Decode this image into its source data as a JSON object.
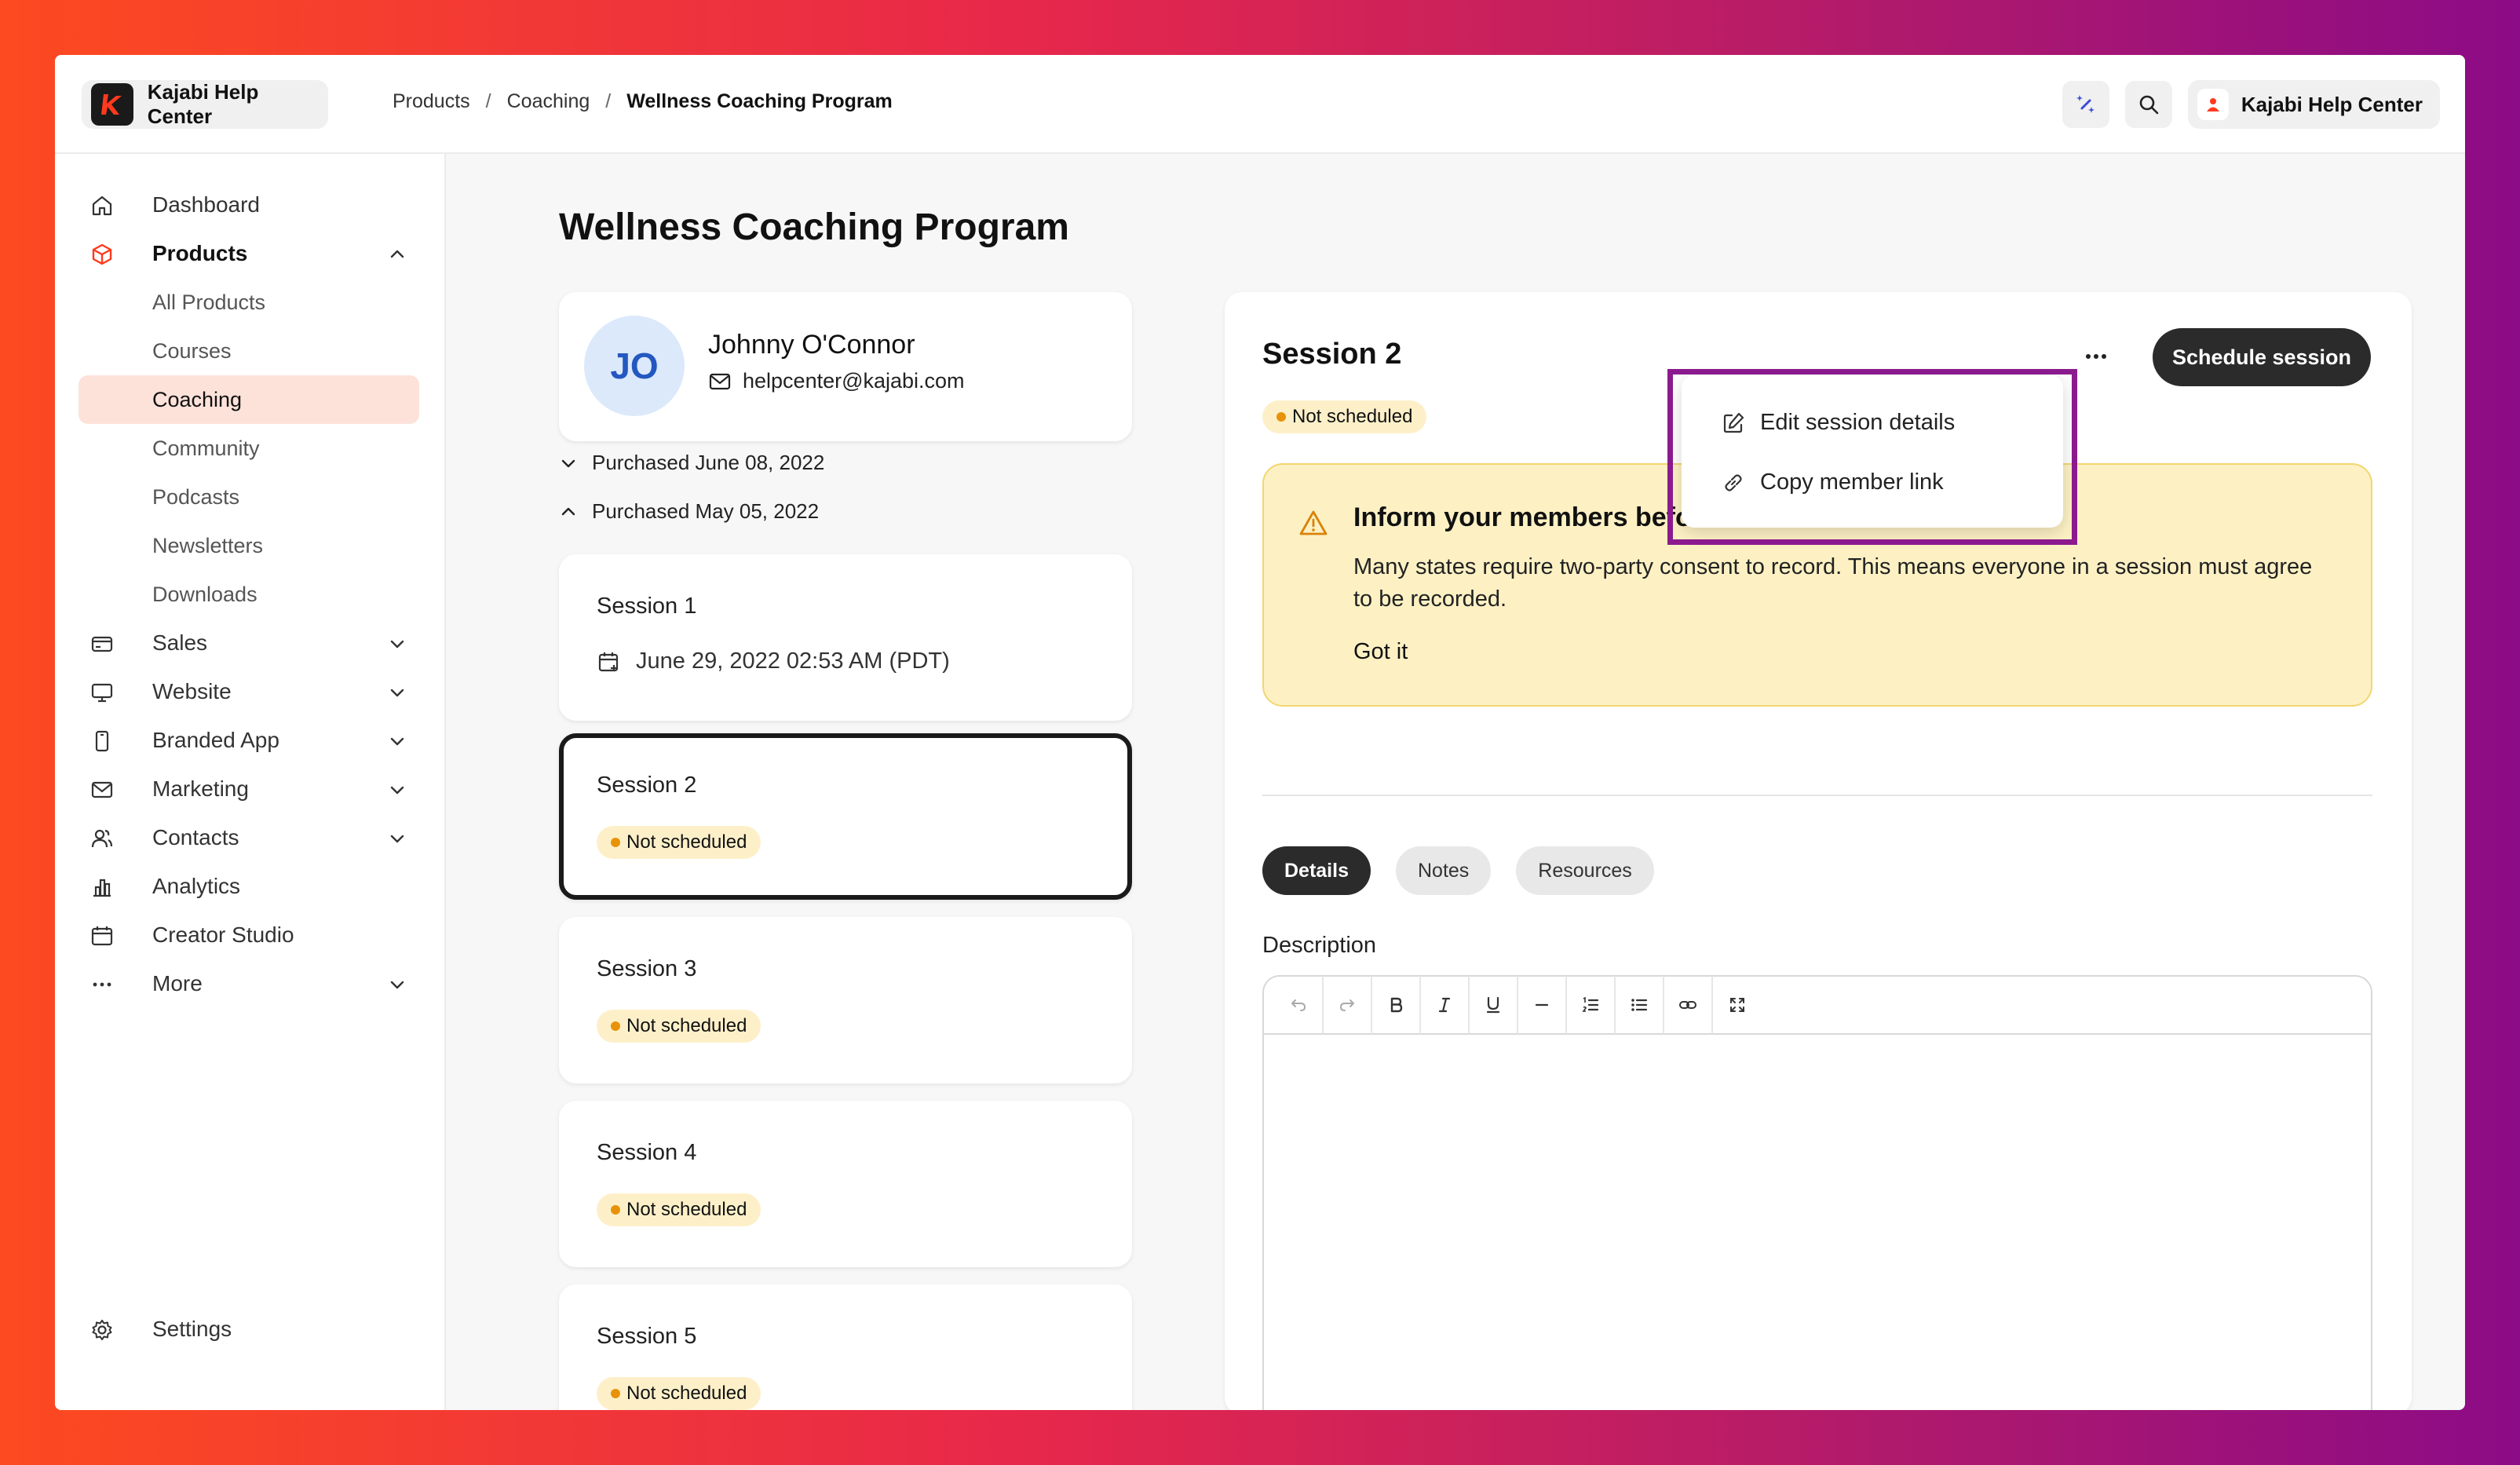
{
  "brand": {
    "name": "Kajabi Help Center",
    "logo_color": "#ff3a1e"
  },
  "breadcrumb": {
    "items": [
      "Products",
      "Coaching"
    ],
    "current": "Wellness Coaching Program",
    "separator": "/"
  },
  "header": {
    "account_name": "Kajabi Help Center",
    "icons": [
      "sparkle-icon",
      "search-icon",
      "user-icon"
    ]
  },
  "sidebar": {
    "items": [
      {
        "label": "Dashboard",
        "icon": "home-icon"
      },
      {
        "label": "Products",
        "icon": "box-icon",
        "expanded": true
      },
      {
        "label": "Sales",
        "icon": "card-icon"
      },
      {
        "label": "Website",
        "icon": "monitor-icon"
      },
      {
        "label": "Branded App",
        "icon": "phone-icon"
      },
      {
        "label": "Marketing",
        "icon": "mail-icon"
      },
      {
        "label": "Contacts",
        "icon": "users-icon"
      },
      {
        "label": "Analytics",
        "icon": "chart-icon"
      },
      {
        "label": "Creator Studio",
        "icon": "calendar-icon"
      },
      {
        "label": "More",
        "icon": "dots-icon"
      }
    ],
    "product_children": [
      "All Products",
      "Courses",
      "Coaching",
      "Community",
      "Podcasts",
      "Newsletters",
      "Downloads"
    ],
    "active_child": "Coaching",
    "settings_label": "Settings"
  },
  "main": {
    "title": "Wellness Coaching Program",
    "profile": {
      "initials": "JO",
      "name": "Johnny O'Connor",
      "email": "helpcenter@kajabi.com"
    },
    "purchases": [
      {
        "label": "Purchased June 08, 2022",
        "expanded": false
      },
      {
        "label": "Purchased May 05, 2022",
        "expanded": true
      }
    ],
    "sessions": [
      {
        "title": "Session 1",
        "date": "June 29, 2022 02:53 AM (PDT)"
      },
      {
        "title": "Session 2",
        "status": "Not scheduled",
        "selected": true
      },
      {
        "title": "Session 3",
        "status": "Not scheduled"
      },
      {
        "title": "Session 4",
        "status": "Not scheduled"
      },
      {
        "title": "Session 5",
        "status": "Not scheduled"
      }
    ]
  },
  "detail": {
    "title": "Session 2",
    "status": "Not scheduled",
    "schedule_button": "Schedule session",
    "warning": {
      "title": "Inform your members before re",
      "body": "Many states require two-party consent to record. This means everyone in a session must agree to be recorded.",
      "dismiss": "Got it"
    },
    "tabs": [
      "Details",
      "Notes",
      "Resources"
    ],
    "active_tab": "Details",
    "description_label": "Description",
    "editor_tools": [
      "undo-icon",
      "redo-icon",
      "bold-icon",
      "italic-icon",
      "underline-icon",
      "horizontal-rule-icon",
      "ordered-list-icon",
      "bullet-list-icon",
      "link-icon",
      "fullscreen-icon"
    ]
  },
  "menu": {
    "items": [
      "Edit session details",
      "Copy member link"
    ]
  },
  "colors": {
    "highlight": "#8b1a8e",
    "badge_bg": "#fdf0c9",
    "badge_dot": "#e8920a",
    "active_nav_bg": "#fde2da",
    "warning_bg": "#fdf1c4"
  }
}
